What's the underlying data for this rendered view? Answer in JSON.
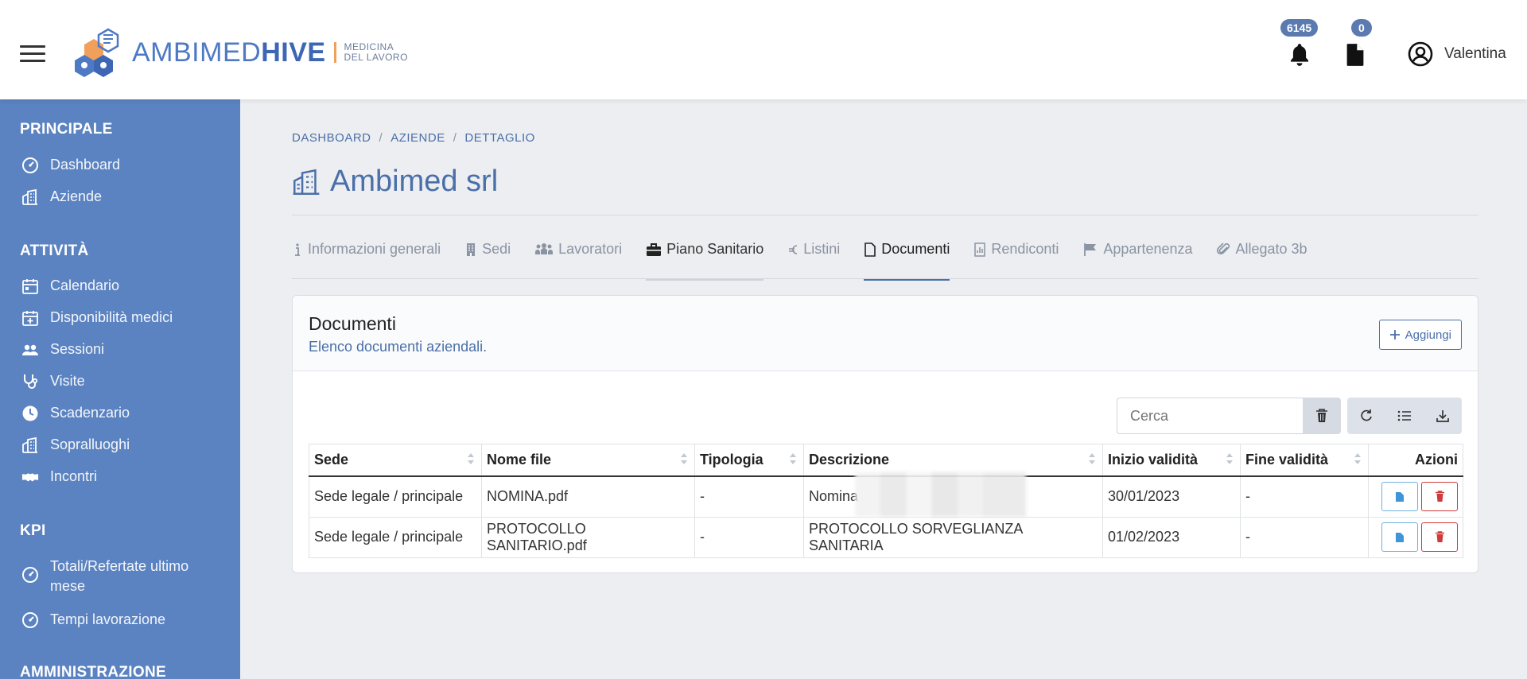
{
  "header": {
    "logo": {
      "brand_a": "AMBIMED",
      "brand_b": "HIVE",
      "sub_line1": "MEDICINA",
      "sub_line2": "DEL LAVORO"
    },
    "notifications_count": "6145",
    "documents_count": "0",
    "user_name": "Valentina"
  },
  "sidebar": {
    "sections": [
      {
        "title": "PRINCIPALE",
        "items": [
          {
            "label": "Dashboard",
            "icon": "gauge-icon"
          },
          {
            "label": "Aziende",
            "icon": "building-icon"
          }
        ]
      },
      {
        "title": "ATTIVITÀ",
        "items": [
          {
            "label": "Calendario",
            "icon": "calendar-icon"
          },
          {
            "label": "Disponibilità medici",
            "icon": "calendar-plus-icon"
          },
          {
            "label": "Sessioni",
            "icon": "users-icon"
          },
          {
            "label": "Visite",
            "icon": "stethoscope-icon"
          },
          {
            "label": "Scadenzario",
            "icon": "clock-icon"
          },
          {
            "label": "Sopralluoghi",
            "icon": "building-icon"
          },
          {
            "label": "Incontri",
            "icon": "handshake-icon"
          }
        ]
      },
      {
        "title": "KPI",
        "items": [
          {
            "label": "Totali/Refertate ultimo mese",
            "icon": "gauge-icon"
          },
          {
            "label": "Tempi lavorazione",
            "icon": "gauge-icon"
          }
        ]
      },
      {
        "title": "AMMINISTRAZIONE",
        "items": []
      }
    ]
  },
  "breadcrumb": [
    "DASHBOARD",
    "AZIENDE",
    "DETTAGLIO"
  ],
  "page_title": "Ambimed srl",
  "tabs": [
    {
      "label": "Informazioni generali",
      "icon": "info-icon"
    },
    {
      "label": "Sedi",
      "icon": "building-small-icon"
    },
    {
      "label": "Lavoratori",
      "icon": "workers-icon"
    },
    {
      "label": "Piano Sanitario",
      "icon": "briefcase-icon"
    },
    {
      "label": "Listini",
      "icon": "euro-icon"
    },
    {
      "label": "Documenti",
      "icon": "file-icon"
    },
    {
      "label": "Rendiconti",
      "icon": "report-icon"
    },
    {
      "label": "Appartenenza",
      "icon": "flag-icon"
    },
    {
      "label": "Allegato 3b",
      "icon": "paperclip-icon"
    }
  ],
  "card": {
    "title": "Documenti",
    "subtitle": "Elenco documenti aziendali.",
    "add_label": "Aggiungi",
    "search_placeholder": "Cerca"
  },
  "table": {
    "columns": [
      "Sede",
      "Nome file",
      "Tipologia",
      "Descrizione",
      "Inizio validità",
      "Fine validità",
      "Azioni"
    ],
    "rows": [
      {
        "sede": "Sede legale / principale",
        "file": "NOMINA.pdf",
        "tipologia": "-",
        "descrizione": "Nomina",
        "inizio": "30/01/2023",
        "fine": "-"
      },
      {
        "sede": "Sede legale / principale",
        "file": "PROTOCOLLO SANITARIO.pdf",
        "tipologia": "-",
        "descrizione": "PROTOCOLLO SORVEGLIANZA SANITARIA",
        "inizio": "01/02/2023",
        "fine": "-"
      }
    ]
  },
  "colors": {
    "sidebar": "#5b83c1",
    "accent": "#4a6fa9",
    "danger": "#d13a3a",
    "info": "#6fb1e0"
  }
}
